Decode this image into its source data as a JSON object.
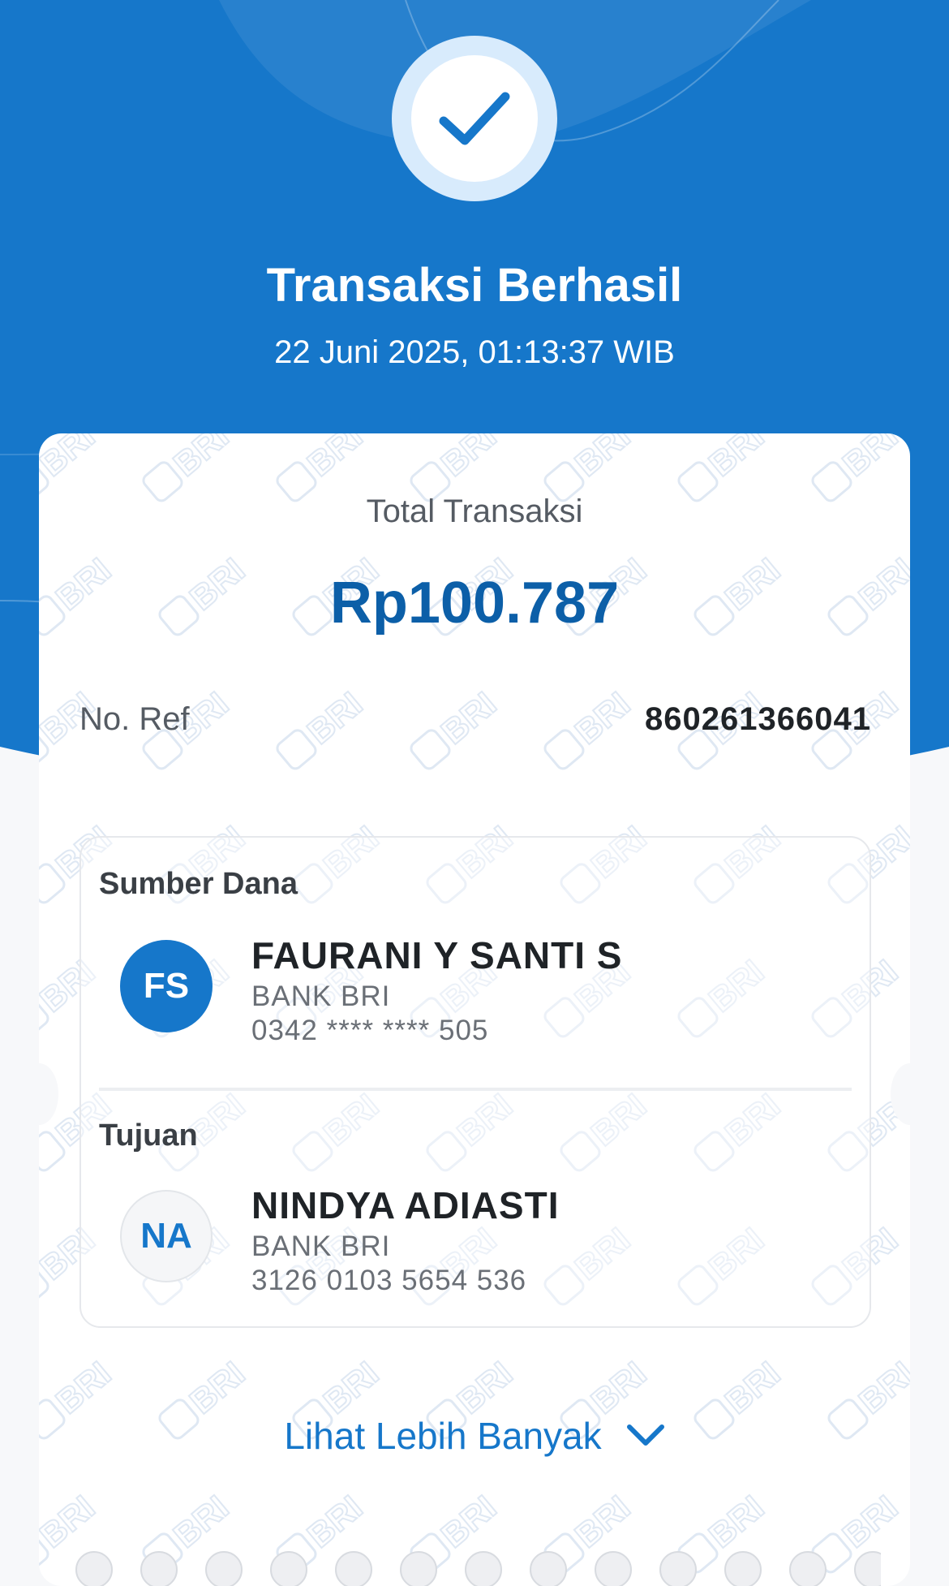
{
  "header": {
    "title": "Transaksi Berhasil",
    "datetime": "22 Juni 2025, 01:13:37 WIB",
    "status_icon": "check-icon"
  },
  "summary": {
    "total_label": "Total Transaksi",
    "total_amount": "Rp100.787",
    "ref_label": "No. Ref",
    "ref_value": "860261366041"
  },
  "source": {
    "section_title": "Sumber Dana",
    "initials": "FS",
    "name": "FAURANI Y SANTI S",
    "bank": "BANK BRI",
    "account": "0342 **** **** 505"
  },
  "destination": {
    "section_title": "Tujuan",
    "initials": "NA",
    "name": "NINDYA ADIASTI",
    "bank": "BANK BRI",
    "account": "3126 0103 5654 536"
  },
  "actions": {
    "see_more_label": "Lihat Lebih Banyak",
    "see_more_icon": "chevron-down-icon"
  },
  "watermark_text": "BRI",
  "colors": {
    "primary": "#1677ca",
    "amount": "#0c5fa8",
    "success_ring": "#d8ebfc"
  }
}
